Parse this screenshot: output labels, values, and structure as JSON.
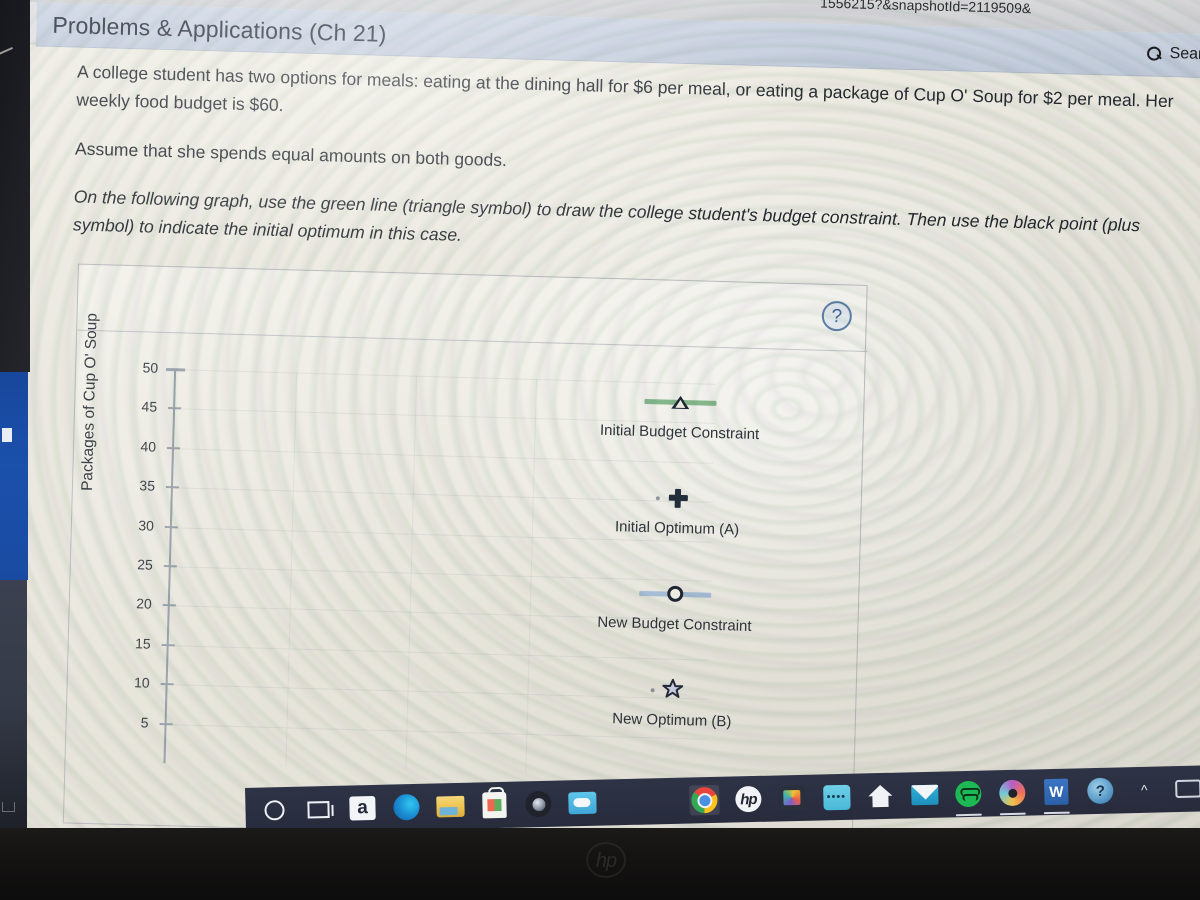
{
  "browser": {
    "url_fragment": "1556215?&snapshotId=2119509&",
    "search_label": "Search th",
    "search_icon": "magnifier-icon"
  },
  "header": {
    "title": "Problems & Applications (Ch 21)"
  },
  "prose": {
    "p1": "A college student has two options for meals: eating at the dining hall for $6 per meal, or eating a package of Cup O' Soup for $2 per meal. Her weekly food budget is $60.",
    "p2": "Assume that she spends equal amounts on both goods.",
    "p3": "On the following graph, use the green line (triangle symbol) to draw the college student's budget constraint. Then use the black point (plus symbol) to indicate the initial optimum in this case."
  },
  "graph_card": {
    "help_button_label": "?"
  },
  "chart_data": {
    "type": "line",
    "title": "",
    "xlabel": "",
    "ylabel": "Packages of Cup O' Soup",
    "ytick_labels": [
      "50",
      "45",
      "40",
      "35",
      "30",
      "25",
      "20",
      "15",
      "10",
      "5"
    ],
    "yticks": [
      50,
      45,
      40,
      35,
      30,
      25,
      20,
      15,
      10,
      5
    ],
    "ylim": [
      0,
      50
    ],
    "grid": true,
    "legend_position": "right",
    "series": [
      {
        "name": "Initial Budget Constraint",
        "marker": "triangle",
        "color": "#86b88d",
        "values": []
      },
      {
        "name": "Initial Optimum (A)",
        "marker": "plus",
        "color": "#232c3a",
        "values": []
      },
      {
        "name": "New Budget Constraint",
        "marker": "circle",
        "color": "#a7bfd8",
        "values": []
      },
      {
        "name": "New Optimum (B)",
        "marker": "star",
        "color": "#2b3444",
        "values": []
      }
    ]
  },
  "legend": [
    {
      "label": "Initial Budget Constraint",
      "marker": "triangle-marker",
      "line": true,
      "line_color": "#86b88d"
    },
    {
      "label": "Initial Optimum (A)",
      "marker": "plus-marker",
      "line": false,
      "line_color": ""
    },
    {
      "label": "New Budget Constraint",
      "marker": "circle-marker",
      "line": true,
      "line_color": "#a7bfd8"
    },
    {
      "label": "New Optimum (B)",
      "marker": "star-marker",
      "line": false,
      "line_color": ""
    }
  ],
  "taskbar": {
    "items": [
      {
        "name": "cortana",
        "icon": "cortana-circle-icon",
        "label": ""
      },
      {
        "name": "task-view",
        "icon": "task-view-icon",
        "label": ""
      },
      {
        "name": "amazon",
        "icon": "amazon-icon",
        "label": "a"
      },
      {
        "name": "edge",
        "icon": "edge-browser-icon",
        "label": ""
      },
      {
        "name": "file-explorer",
        "icon": "folder-icon",
        "label": ""
      },
      {
        "name": "microsoft-store",
        "icon": "store-bag-icon",
        "label": ""
      },
      {
        "name": "camera",
        "icon": "camera-icon",
        "label": ""
      },
      {
        "name": "weather",
        "icon": "weather-cloud-icon",
        "label": ""
      },
      {
        "name": "chrome",
        "icon": "chrome-icon",
        "label": ""
      },
      {
        "name": "hp-support",
        "icon": "hp-logo-icon",
        "label": "hp"
      },
      {
        "name": "photos",
        "icon": "photos-icon",
        "label": ""
      },
      {
        "name": "password-manager",
        "icon": "password-icon",
        "label": "••••"
      },
      {
        "name": "home",
        "icon": "home-icon",
        "label": ""
      },
      {
        "name": "mail",
        "icon": "mail-envelope-icon",
        "label": ""
      },
      {
        "name": "spotify",
        "icon": "spotify-icon",
        "label": ""
      },
      {
        "name": "media-player",
        "icon": "disc-icon",
        "label": ""
      },
      {
        "name": "word",
        "icon": "word-icon",
        "label": "W"
      },
      {
        "name": "help",
        "icon": "help-circle-icon",
        "label": "?"
      },
      {
        "name": "show-hidden-icons",
        "icon": "chevron-up-icon",
        "label": "^"
      },
      {
        "name": "battery",
        "icon": "battery-icon",
        "label": ""
      }
    ]
  }
}
